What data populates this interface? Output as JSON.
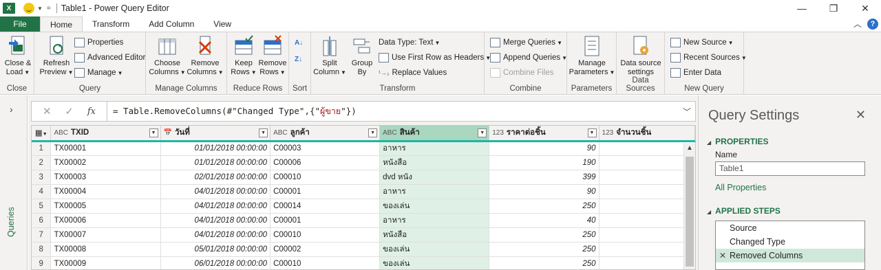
{
  "title_bar": {
    "title": "Table1 - Power Query Editor",
    "logo": "X",
    "buttons": [
      "minimize-icon",
      "restore-icon",
      "close-icon"
    ]
  },
  "tabs": [
    "File",
    "Home",
    "Transform",
    "Add Column",
    "View"
  ],
  "active_tab": "Home",
  "ribbon": {
    "close": {
      "label1": "Close &",
      "label2": "Load",
      "group": "Close"
    },
    "query": {
      "refresh1": "Refresh",
      "refresh2": "Preview",
      "properties": "Properties",
      "advanced_editor": "Advanced Editor",
      "manage": "Manage",
      "group": "Query"
    },
    "manage_columns": {
      "choose1": "Choose",
      "choose2": "Columns",
      "remove1": "Remove",
      "remove2": "Columns",
      "group": "Manage Columns"
    },
    "reduce_rows": {
      "keep1": "Keep",
      "keep2": "Rows",
      "remove1": "Remove",
      "remove2": "Rows",
      "group": "Reduce Rows"
    },
    "sort": {
      "group": "Sort"
    },
    "transform": {
      "split1": "Split",
      "split2": "Column",
      "group_by1": "Group",
      "group_by2": "By",
      "data_type": "Data Type: Text",
      "first_row": "Use First Row as Headers",
      "replace": "Replace Values",
      "group": "Transform"
    },
    "combine": {
      "merge": "Merge Queries",
      "append": "Append Queries",
      "combine_files": "Combine Files",
      "group": "Combine"
    },
    "parameters": {
      "manage1": "Manage",
      "manage2": "Parameters",
      "group": "Parameters"
    },
    "data_sources": {
      "label1": "Data source",
      "label2": "settings",
      "group": "Data Sources"
    },
    "new_query": {
      "new_source": "New Source",
      "recent_sources": "Recent Sources",
      "enter_data": "Enter Data",
      "group": "New Query"
    }
  },
  "left_pane": {
    "label": "Queries"
  },
  "formula_bar": {
    "prefix": "= Table.RemoveColumns(#\"Changed Type\",{\"",
    "string": "ผู้ขาย",
    "suffix": "\"})"
  },
  "columns": [
    {
      "type": "ABC",
      "name": "TXID"
    },
    {
      "type": "date",
      "name": "วันที่"
    },
    {
      "type": "ABC",
      "name": "ลูกค้า"
    },
    {
      "type": "ABC",
      "name": "สินค้า"
    },
    {
      "type": "123",
      "name": "ราคาต่อชิ้น"
    },
    {
      "type": "123",
      "name": "จำนวนชิ้น"
    }
  ],
  "rows": [
    {
      "n": "1",
      "txid": "TX00001",
      "date": "01/01/2018 00:00:00",
      "customer": "C00003",
      "product": "อาหาร",
      "price": "90"
    },
    {
      "n": "2",
      "txid": "TX00002",
      "date": "01/01/2018 00:00:00",
      "customer": "C00006",
      "product": "หนังสือ",
      "price": "190"
    },
    {
      "n": "3",
      "txid": "TX00003",
      "date": "02/01/2018 00:00:00",
      "customer": "C00010",
      "product": "dvd หนัง",
      "price": "399"
    },
    {
      "n": "4",
      "txid": "TX00004",
      "date": "04/01/2018 00:00:00",
      "customer": "C00001",
      "product": "อาหาร",
      "price": "90"
    },
    {
      "n": "5",
      "txid": "TX00005",
      "date": "04/01/2018 00:00:00",
      "customer": "C00014",
      "product": "ของเล่น",
      "price": "250"
    },
    {
      "n": "6",
      "txid": "TX00006",
      "date": "04/01/2018 00:00:00",
      "customer": "C00001",
      "product": "อาหาร",
      "price": "40"
    },
    {
      "n": "7",
      "txid": "TX00007",
      "date": "04/01/2018 00:00:00",
      "customer": "C00010",
      "product": "หนังสือ",
      "price": "250"
    },
    {
      "n": "8",
      "txid": "TX00008",
      "date": "05/01/2018 00:00:00",
      "customer": "C00002",
      "product": "ของเล่น",
      "price": "250"
    },
    {
      "n": "9",
      "txid": "TX00009",
      "date": "06/01/2018 00:00:00",
      "customer": "C00010",
      "product": "ของเล่น",
      "price": "250"
    }
  ],
  "query_settings": {
    "title": "Query Settings",
    "properties": "PROPERTIES",
    "name_label": "Name",
    "name_value": "Table1",
    "all_properties": "All Properties",
    "applied_steps": "APPLIED STEPS",
    "steps": [
      "Source",
      "Changed Type",
      "Removed Columns"
    ]
  },
  "colors": {
    "brand": "#217346",
    "selected_column": "#dff0e7",
    "header_accent": "#1fb5a5"
  }
}
